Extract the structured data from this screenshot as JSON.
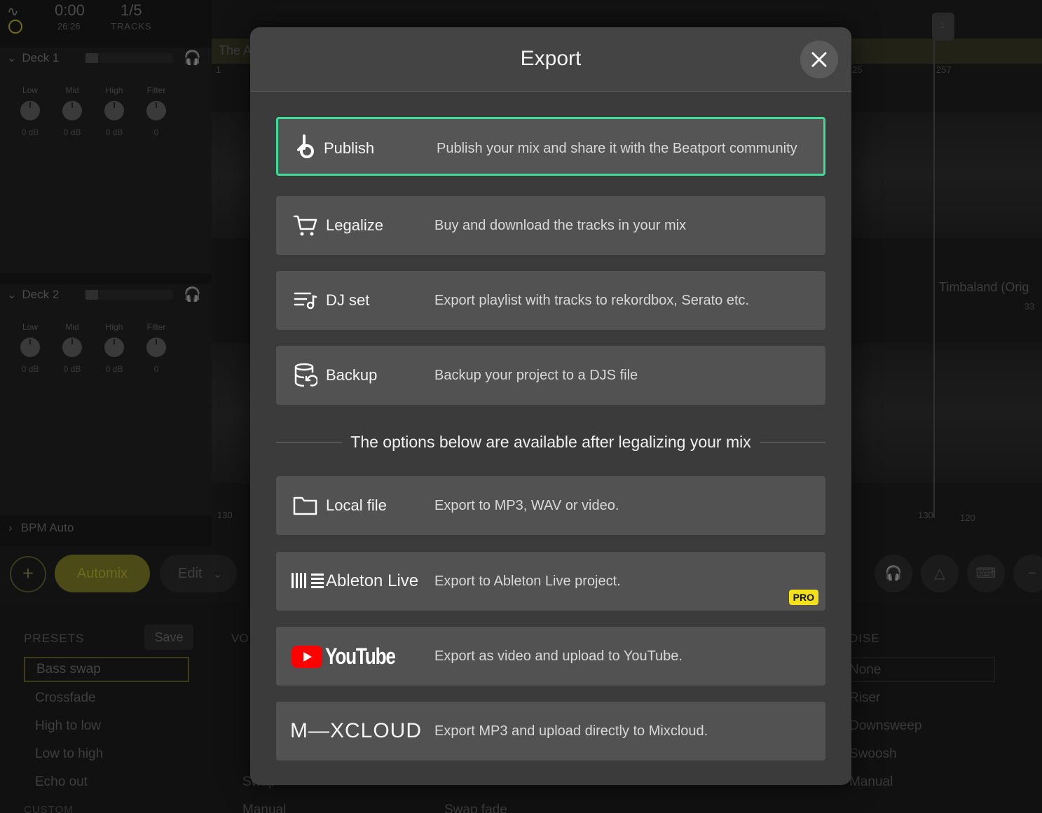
{
  "app": {
    "time": "0:00",
    "time_total": "26:26",
    "track_pos": "1/5",
    "tracks_label": "TRACKS",
    "deck1": {
      "label": "Deck 1",
      "knobs": [
        {
          "label": "Low",
          "value": "0 dB"
        },
        {
          "label": "Mid",
          "value": "0 dB"
        },
        {
          "label": "High",
          "value": "0 dB"
        },
        {
          "label": "Filter",
          "value": "0"
        }
      ]
    },
    "deck2": {
      "label": "Deck 2",
      "knobs": [
        {
          "label": "Low",
          "value": "0 dB"
        },
        {
          "label": "Mid",
          "value": "0 dB"
        },
        {
          "label": "High",
          "value": "0 dB"
        },
        {
          "label": "Filter",
          "value": "0"
        }
      ]
    },
    "bpm_auto": "BPM Auto",
    "timeline": {
      "track_title_1": "The A",
      "track_title_2": "Timbaland (Orig",
      "bar_1": "1",
      "bar_25": "25",
      "bar_257": "257",
      "bar_33": "33",
      "bpm_130_left": "130",
      "bpm_130_right": "130",
      "bpm_120": "120",
      "playhead_num": "1"
    },
    "toolbar": {
      "add_symbol": "+",
      "automix_label": "Automix",
      "edit_label": "Edit"
    },
    "presets": {
      "title": "PRESETS",
      "save_label": "Save",
      "selected": "Bass swap",
      "items": [
        "Crossfade",
        "High to low",
        "Low to high",
        "Echo out"
      ],
      "custom_title": "CUSTOM"
    },
    "columns": {
      "vo_title": "VO",
      "swap_label": "Swap",
      "manual_label": "Manual",
      "swap_fade": "Swap fade",
      "noise_title": "DISE",
      "noise_items": [
        "None",
        "Riser",
        "Downsweep",
        "Swoosh",
        "Manual"
      ]
    }
  },
  "modal": {
    "title": "Export",
    "divider_text": "The options below are available after legalizing your mix",
    "options": [
      {
        "label": "Publish",
        "desc": "Publish your mix and share it with the Beatport community",
        "icon": "beatport-icon",
        "selected": true
      },
      {
        "label": "Legalize",
        "desc": "Buy and download the tracks in your mix",
        "icon": "cart-icon"
      },
      {
        "label": "DJ set",
        "desc": "Export playlist with tracks to rekordbox, Serato etc.",
        "icon": "playlist-icon"
      },
      {
        "label": "Backup",
        "desc": "Backup your project to a DJS file",
        "icon": "database-icon"
      },
      {
        "label": "Local file",
        "desc": "Export to MP3, WAV or video.",
        "icon": "folder-icon"
      },
      {
        "label": "Ableton Live",
        "desc": "Export to Ableton Live project.",
        "icon": "ableton-icon",
        "badge": "PRO"
      },
      {
        "label": "YouTube",
        "desc": "Export as video and upload to YouTube.",
        "icon": "youtube-icon"
      },
      {
        "label": "M—XCLOUD",
        "desc": "Export MP3 and upload directly to Mixcloud.",
        "icon": "mixcloud-icon"
      }
    ]
  },
  "colors": {
    "accent_green": "#3ddc97",
    "pro_yellow": "#f1e01a",
    "youtube_red": "#ff0000",
    "modal_bg": "#3b3b3b",
    "option_bg": "#525252"
  }
}
